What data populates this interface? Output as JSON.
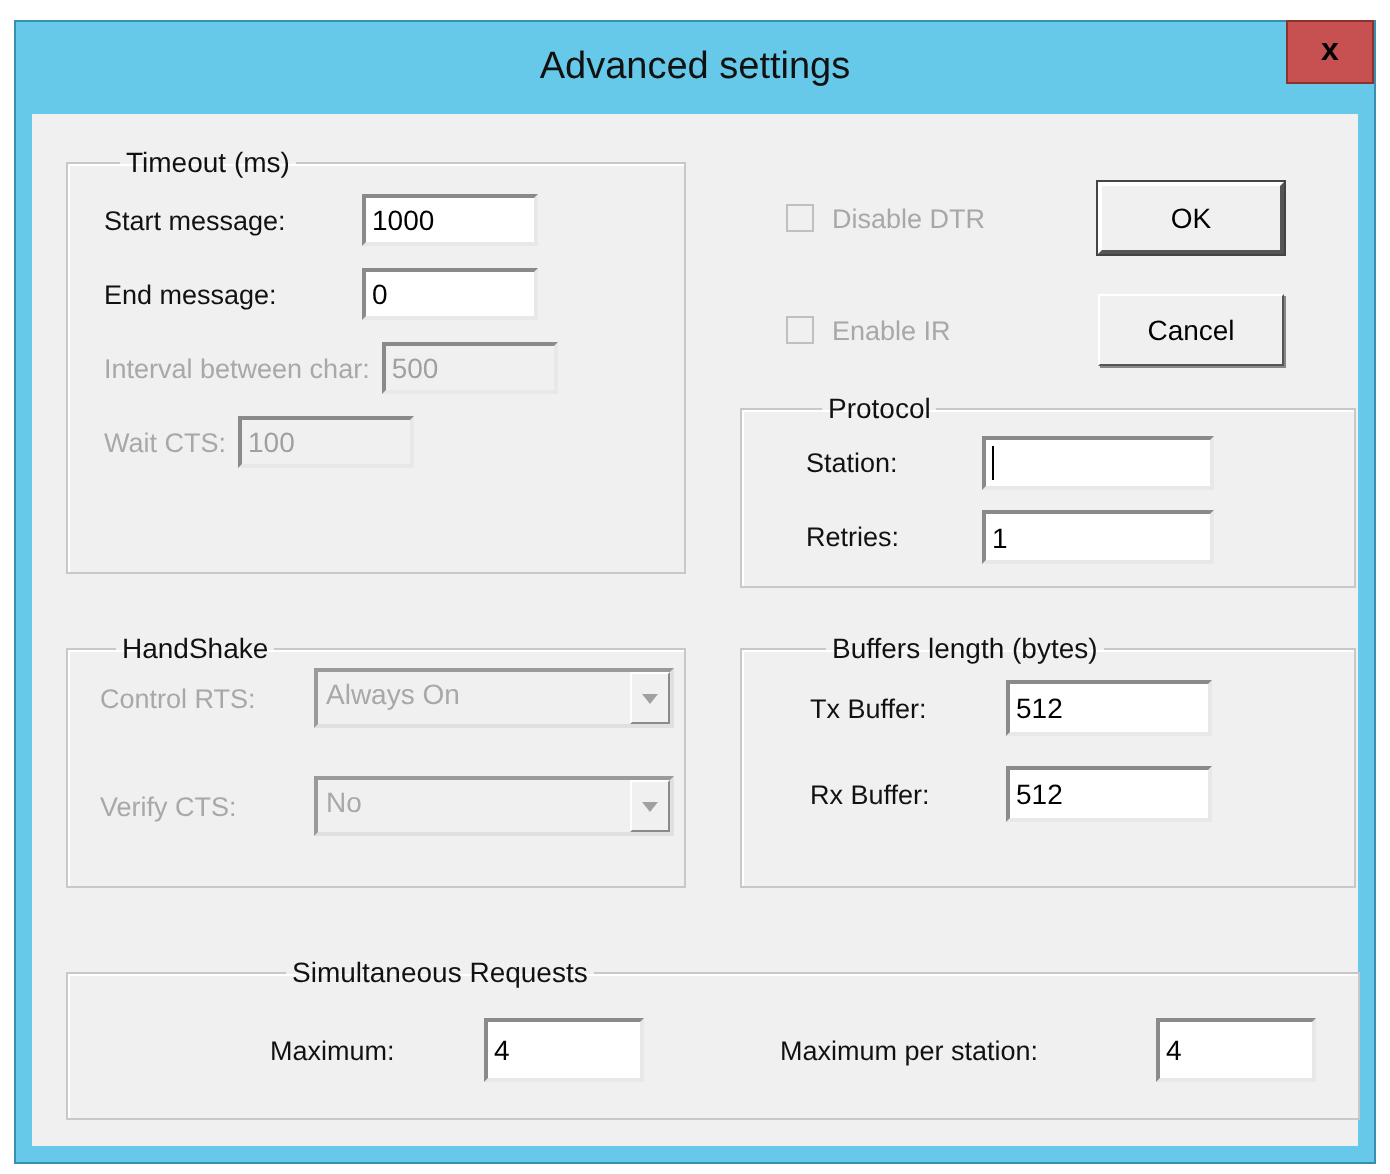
{
  "window": {
    "title": "Advanced settings",
    "close_label": "x"
  },
  "timeout": {
    "title": "Timeout (ms)",
    "fields": [
      {
        "label": "Start message:",
        "value": "1000",
        "disabled": false
      },
      {
        "label": "End message:",
        "value": "0",
        "disabled": false
      },
      {
        "label": "Interval between char:",
        "value": "500",
        "disabled": true
      },
      {
        "label": "Wait CTS:",
        "value": "100",
        "disabled": true
      }
    ]
  },
  "options": [
    {
      "label": "Disable DTR",
      "checked": false,
      "disabled": true
    },
    {
      "label": "Enable IR",
      "checked": false,
      "disabled": true
    }
  ],
  "buttons": [
    {
      "label": "OK",
      "default": true
    },
    {
      "label": "Cancel",
      "default": false
    }
  ],
  "protocol": {
    "title": "Protocol",
    "fields": [
      {
        "label": "Station:",
        "focused": true
      },
      {
        "label": "Retries:",
        "value": "1",
        "focused": false
      }
    ]
  },
  "handshake": {
    "title": "HandShake",
    "combos": [
      {
        "label": "Control RTS:",
        "value": "Always On",
        "disabled": true
      },
      {
        "label": "Verify CTS:",
        "value": "No",
        "disabled": true
      }
    ]
  },
  "buffers": {
    "title": "Buffers length (bytes)",
    "fields": [
      {
        "label": "Tx Buffer:",
        "value": "512"
      },
      {
        "label": "Rx Buffer:",
        "value": "512"
      }
    ]
  },
  "requests": {
    "title": "Simultaneous Requests",
    "fields": [
      {
        "label": "Maximum:",
        "value": "4"
      },
      {
        "label": "Maximum per station:",
        "value": "4"
      }
    ]
  }
}
